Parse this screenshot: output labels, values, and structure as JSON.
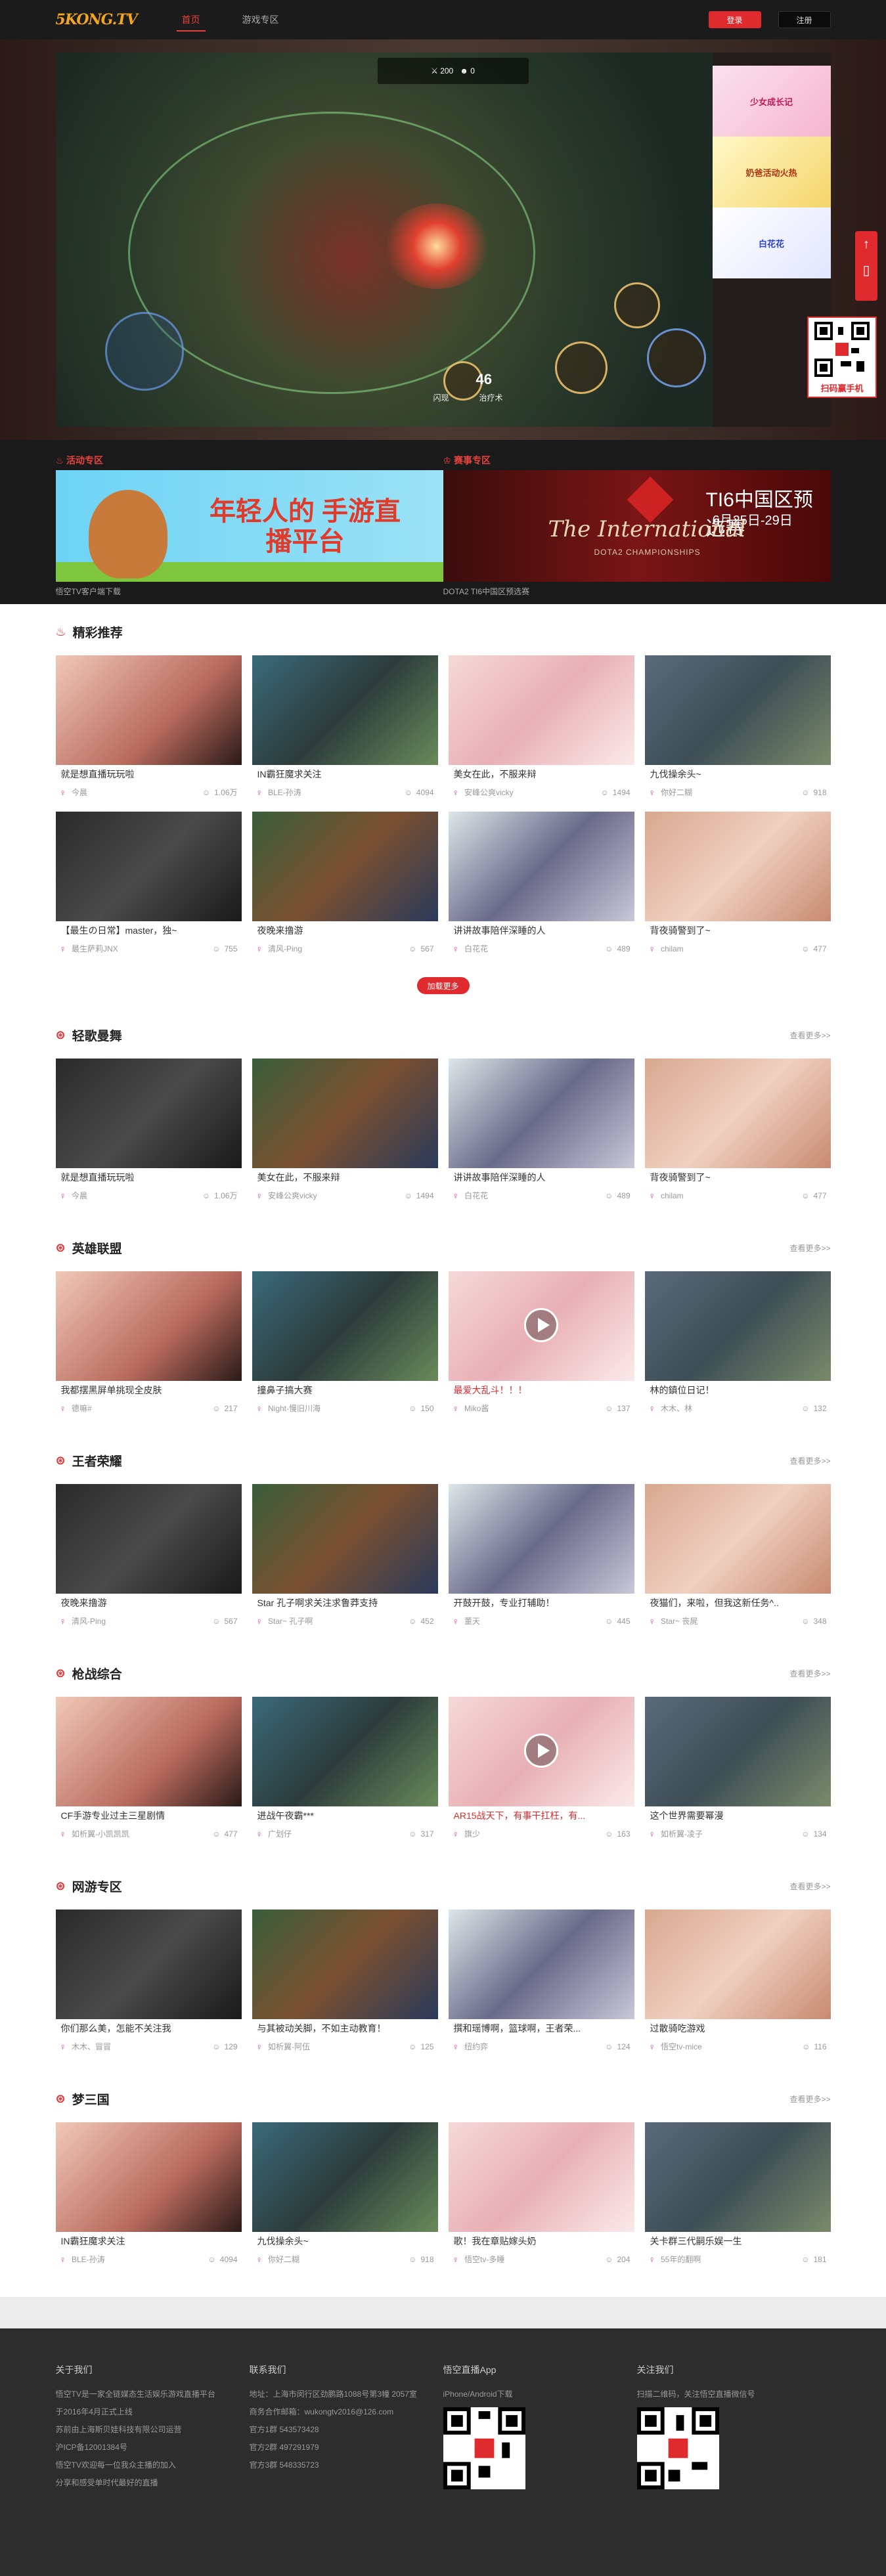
{
  "header": {
    "logo": "5KONG.TV",
    "nav": [
      "首页",
      "游戏专区"
    ],
    "login": "登录",
    "register": "注册"
  },
  "hero": {
    "hud_kills": "200",
    "hud_score": "0",
    "hp": "46",
    "hp_caption": "治疗术",
    "skill_caption": "闪现"
  },
  "side_ads": [
    {
      "text": "少女成长记"
    },
    {
      "text": "奶爸活动火热"
    },
    {
      "text": "白花花"
    }
  ],
  "float": {
    "top_arrow": "↑",
    "phone": "▯",
    "qr_label": "扫码赢手机"
  },
  "promo": {
    "left": {
      "title": "活动专区",
      "banner_text": "年轻人的 手游直播平台",
      "caption": "悟空TV客户端下载"
    },
    "right": {
      "title": "赛事专区",
      "t1": "TI6中国区预选赛",
      "t2": "6月25日-29日",
      "t3": "The International",
      "t4": "DOTA2 CHAMPIONSHIPS",
      "caption": "DOTA2 TI6中国区预选赛"
    }
  },
  "sections": [
    {
      "title": "精彩推荐",
      "more": "",
      "cards": [
        {
          "title": "就是想直播玩玩啦",
          "user": "今晨",
          "views": "1.06万"
        },
        {
          "title": "IN霸狂魔求关注",
          "user": "BLE-孙涛",
          "views": "4094"
        },
        {
          "title": "美女在此，不服来辩",
          "user": "安峰公爽vicky",
          "views": "1494"
        },
        {
          "title": "九伐操余头~",
          "user": "你好二糊",
          "views": "918"
        },
        {
          "title": "【最生の日常】master，独~",
          "user": "最生萨莉JNX",
          "views": "755"
        },
        {
          "title": "夜晚来撸游",
          "user": "清风-Ping",
          "views": "567"
        },
        {
          "title": "讲讲故事陪伴深睡的人",
          "user": "白花花",
          "views": "489"
        },
        {
          "title": "背夜骑警到了~",
          "user": "chilam",
          "views": "477"
        }
      ],
      "loadmore": "加载更多"
    },
    {
      "title": "轻歌曼舞",
      "more": "查看更多>>",
      "cards": [
        {
          "title": "就是想直播玩玩啦",
          "user": "今晨",
          "views": "1.06万"
        },
        {
          "title": "美女在此，不服来辩",
          "user": "安峰公爽vicky",
          "views": "1494"
        },
        {
          "title": "讲讲故事陪伴深睡的人",
          "user": "白花花",
          "views": "489"
        },
        {
          "title": "背夜骑警到了~",
          "user": "chilam",
          "views": "477"
        }
      ]
    },
    {
      "title": "英雄联盟",
      "more": "查看更多>>",
      "cards": [
        {
          "title": "我都摆黑屏单挑现全皮肤",
          "user": "德嘛#",
          "views": "217"
        },
        {
          "title": "撞鼻子搞大赛",
          "user": "Night-慢旧川海",
          "views": "150"
        },
        {
          "title": "最爱大乱斗！！！",
          "user": "Miko酱",
          "views": "137",
          "red": true
        },
        {
          "title": "林的鎮位日记！",
          "user": "木木、林",
          "views": "132"
        }
      ]
    },
    {
      "title": "王者荣耀",
      "more": "查看更多>>",
      "cards": [
        {
          "title": "夜晚来撸游",
          "user": "清风-Ping",
          "views": "567"
        },
        {
          "title": "Star 孔子啊求关注求鲁莽支持",
          "user": "Star~ 孔子啊",
          "views": "452"
        },
        {
          "title": "开鼓开鼓，专业打辅助！",
          "user": "董天",
          "views": "445"
        },
        {
          "title": "夜猫们，来啦，但我这新任务^..",
          "user": "Star~ 丧屍",
          "views": "348"
        }
      ]
    },
    {
      "title": "枪战综合",
      "more": "查看更多>>",
      "cards": [
        {
          "title": "CF手游专业过主三星剧情",
          "user": "如析翼-小凯凯凯",
          "views": "477"
        },
        {
          "title": "进战午夜霸***",
          "user": "广划仔",
          "views": "317"
        },
        {
          "title": "AR15战天下，有事干扛枉，有...",
          "user": "旗少",
          "views": "163",
          "red": true
        },
        {
          "title": "这个世界需要幂漫",
          "user": "如析翼-凌子",
          "views": "134"
        }
      ]
    },
    {
      "title": "网游专区",
      "more": "查看更多>>",
      "cards": [
        {
          "title": "你们那么美，怎能不关注我",
          "user": "木木、冒冒",
          "views": "129"
        },
        {
          "title": "与其被动关脚，不如主动教育！",
          "user": "如析翼-阿伍",
          "views": "125"
        },
        {
          "title": "撰和瑶博啊，篮球啊，王者荣...",
          "user": "纽约弈",
          "views": "124"
        },
        {
          "title": "过散骑吃游戏",
          "user": "悟空tv-mice",
          "views": "116"
        }
      ]
    },
    {
      "title": "梦三国",
      "more": "查看更多>>",
      "cards": [
        {
          "title": "IN霸狂魔求关注",
          "user": "BLE-孙涛",
          "views": "4094"
        },
        {
          "title": "九伐操余头~",
          "user": "你好二糊",
          "views": "918"
        },
        {
          "title": "歌！我在章贴嫁头奶",
          "user": "悟空tv-多睡",
          "views": "204"
        },
        {
          "title": "关卡群三代嗣乐娱一生",
          "user": "55年的翻啊",
          "views": "181"
        }
      ]
    }
  ],
  "footer": {
    "about": {
      "title": "关于我们",
      "lines": [
        "悟空TV是一家全链媒态生活娱乐游戏直播平台",
        "于2016年4月正式上线",
        "苏前由上海斯贝娃科技有限公司运营",
        "沪ICP备12001384号",
        "悟空TV欢迎每一位我众主播的加入",
        "分享和感受单时代最好的直播"
      ]
    },
    "contact": {
      "title": "联系我们",
      "lines": [
        "地址：上海市闵行区劲鹏路1088号第3幢 2057室",
        "商务合作邮箱：wukongtv2016@126.com",
        "官方1群 543573428",
        "官方2群 497291979",
        "官方3群 548335723"
      ]
    },
    "app": {
      "title": "悟空直播App",
      "lines": [
        "iPhone/Android下载"
      ]
    },
    "follow": {
      "title": "关注我们",
      "lines": [
        "扫描二维码，关注悟空直播微信号"
      ]
    }
  }
}
